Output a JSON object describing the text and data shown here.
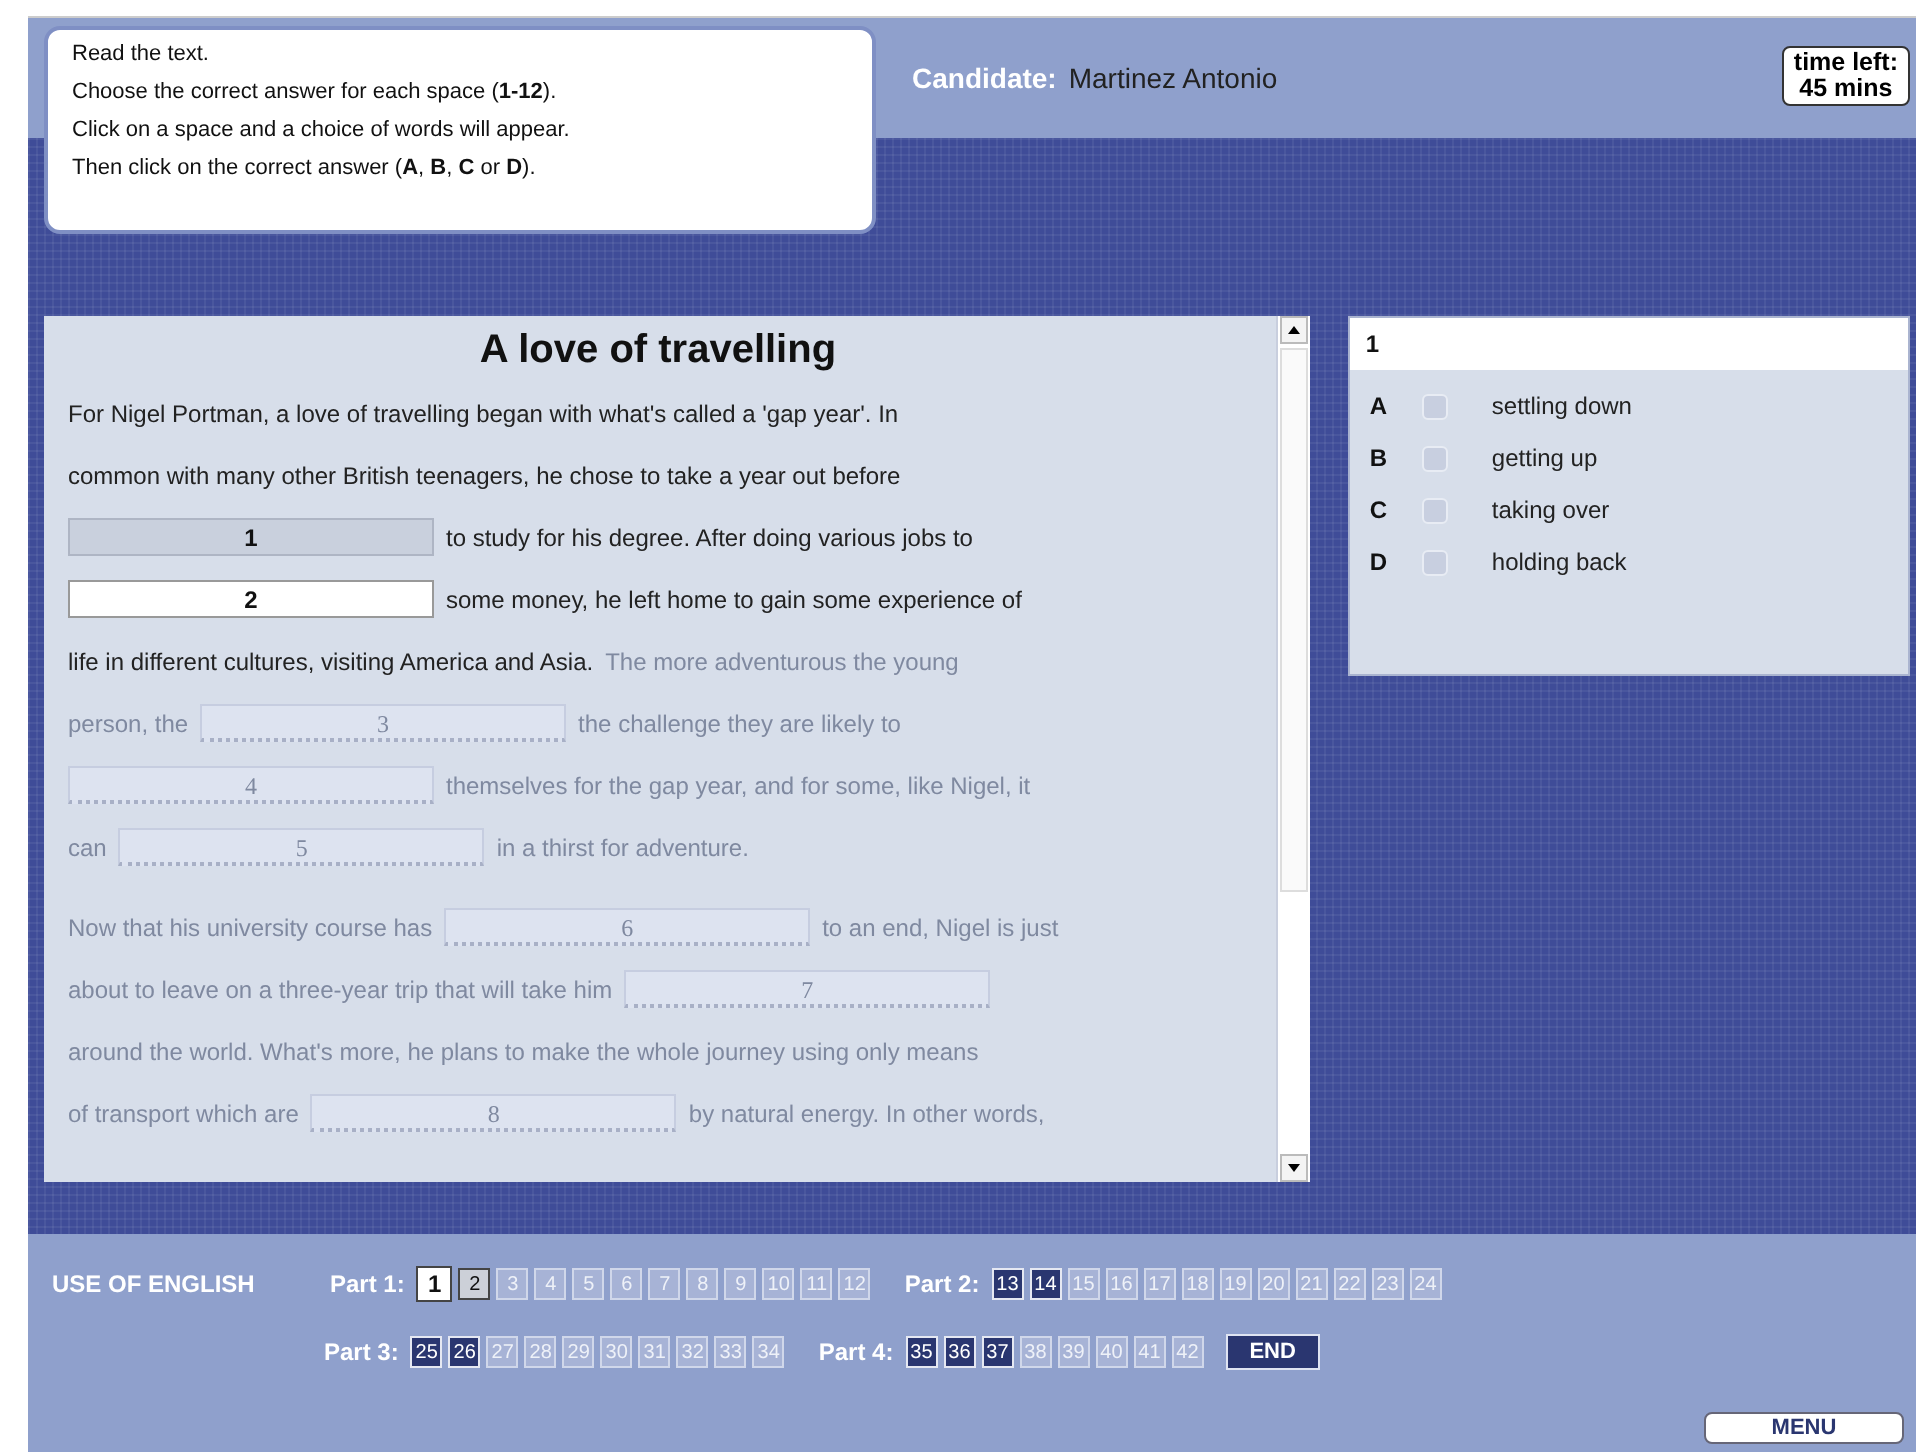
{
  "instructions": [
    "Read the text.",
    "Choose the correct answer for each space (**1-12**).",
    "Click on a space and a choice of words will appear.",
    "Then click on the correct answer (**A**, **B**, **C** or **D**)."
  ],
  "candidate": {
    "label": "Candidate:",
    "name": "Martinez Antonio"
  },
  "timer": {
    "label": "time left:",
    "value": "45 mins"
  },
  "passage": {
    "title": "A love of travelling",
    "paragraphs": [
      [
        [
          {
            "kind": "text",
            "text": "For Nigel Portman, a love of travelling began with what's called a 'gap year'. In",
            "faded": false
          }
        ],
        [
          {
            "kind": "text",
            "text": "common with many other British teenagers, he chose to take a year out before",
            "faded": false
          }
        ],
        [
          {
            "kind": "gap",
            "label": "1",
            "selected": true,
            "faded": false
          },
          {
            "kind": "text",
            "text": "to study for his degree. After doing various jobs to",
            "faded": false
          }
        ],
        [
          {
            "kind": "gap",
            "label": "2",
            "selected": false,
            "faded": false
          },
          {
            "kind": "text",
            "text": "some money, he left home to gain some experience of",
            "faded": false
          }
        ],
        [
          {
            "kind": "text",
            "text": "life in different cultures, visiting America and Asia.",
            "faded": false
          },
          {
            "kind": "text",
            "text": "The more adventurous the young",
            "faded": true
          }
        ],
        [
          {
            "kind": "text",
            "text": "person, the",
            "faded": true
          },
          {
            "kind": "gap",
            "label": "3",
            "selected": false,
            "faded": true
          },
          {
            "kind": "text",
            "text": "the challenge they are likely to",
            "faded": true
          }
        ],
        [
          {
            "kind": "gap",
            "label": "4",
            "selected": false,
            "faded": true
          },
          {
            "kind": "text",
            "text": "themselves for the gap year, and for some, like Nigel, it",
            "faded": true
          }
        ],
        [
          {
            "kind": "text",
            "text": "can",
            "faded": true
          },
          {
            "kind": "gap",
            "label": "5",
            "selected": false,
            "faded": true
          },
          {
            "kind": "text",
            "text": "in a thirst for adventure.",
            "faded": true
          }
        ]
      ],
      [
        [
          {
            "kind": "text",
            "text": "Now that his university course has",
            "faded": true
          },
          {
            "kind": "gap",
            "label": "6",
            "selected": false,
            "faded": true
          },
          {
            "kind": "text",
            "text": "to an end, Nigel is just",
            "faded": true
          }
        ],
        [
          {
            "kind": "text",
            "text": "about to leave on a three-year trip that will take him",
            "faded": true
          },
          {
            "kind": "gap",
            "label": "7",
            "selected": false,
            "faded": true
          }
        ],
        [
          {
            "kind": "text",
            "text": "around the world. What's more, he plans to make the whole journey using only means",
            "faded": true
          }
        ],
        [
          {
            "kind": "text",
            "text": "of transport which are",
            "faded": true
          },
          {
            "kind": "gap",
            "label": "8",
            "selected": false,
            "faded": true
          },
          {
            "kind": "text",
            "text": "by natural energy. In other words,",
            "faded": true
          }
        ]
      ]
    ]
  },
  "answers": {
    "question": "1",
    "options": [
      {
        "letter": "A",
        "text": "settling down",
        "checked": false
      },
      {
        "letter": "B",
        "text": "getting up",
        "checked": false
      },
      {
        "letter": "C",
        "text": "taking over",
        "checked": false
      },
      {
        "letter": "D",
        "text": "holding back",
        "checked": false
      }
    ]
  },
  "navigation": {
    "title": "USE OF ENGLISH",
    "rows": [
      [
        {
          "label": "Part 1:",
          "items": [
            {
              "label": "1",
              "selected": true,
              "visited": true,
              "answered": false
            },
            {
              "label": "2",
              "selected": false,
              "visited": true,
              "answered": false
            },
            {
              "label": "3",
              "selected": false,
              "visited": false,
              "answered": false
            },
            {
              "label": "4",
              "selected": false,
              "visited": false,
              "answered": false
            },
            {
              "label": "5",
              "selected": false,
              "visited": false,
              "answered": false
            },
            {
              "label": "6",
              "selected": false,
              "visited": false,
              "answered": false
            },
            {
              "label": "7",
              "selected": false,
              "visited": false,
              "answered": false
            },
            {
              "label": "8",
              "selected": false,
              "visited": false,
              "answered": false
            },
            {
              "label": "9",
              "selected": false,
              "visited": false,
              "answered": false
            },
            {
              "label": "10",
              "selected": false,
              "visited": false,
              "answered": false
            },
            {
              "label": "11",
              "selected": false,
              "visited": false,
              "answered": false
            },
            {
              "label": "12",
              "selected": false,
              "visited": false,
              "answered": false
            }
          ]
        },
        {
          "label": "Part 2:",
          "items": [
            {
              "label": "13",
              "selected": false,
              "visited": true,
              "answered": true
            },
            {
              "label": "14",
              "selected": false,
              "visited": true,
              "answered": true
            },
            {
              "label": "15",
              "selected": false,
              "visited": false,
              "answered": false
            },
            {
              "label": "16",
              "selected": false,
              "visited": false,
              "answered": false
            },
            {
              "label": "17",
              "selected": false,
              "visited": false,
              "answered": false
            },
            {
              "label": "18",
              "selected": false,
              "visited": false,
              "answered": false
            },
            {
              "label": "19",
              "selected": false,
              "visited": false,
              "answered": false
            },
            {
              "label": "20",
              "selected": false,
              "visited": false,
              "answered": false
            },
            {
              "label": "21",
              "selected": false,
              "visited": false,
              "answered": false
            },
            {
              "label": "22",
              "selected": false,
              "visited": false,
              "answered": false
            },
            {
              "label": "23",
              "selected": false,
              "visited": false,
              "answered": false
            },
            {
              "label": "24",
              "selected": false,
              "visited": false,
              "answered": false
            }
          ]
        }
      ],
      [
        {
          "label": "Part 3:",
          "items": [
            {
              "label": "25",
              "selected": false,
              "visited": true,
              "answered": true
            },
            {
              "label": "26",
              "selected": false,
              "visited": true,
              "answered": true
            },
            {
              "label": "27",
              "selected": false,
              "visited": false,
              "answered": false
            },
            {
              "label": "28",
              "selected": false,
              "visited": false,
              "answered": false
            },
            {
              "label": "29",
              "selected": false,
              "visited": false,
              "answered": false
            },
            {
              "label": "30",
              "selected": false,
              "visited": false,
              "answered": false
            },
            {
              "label": "31",
              "selected": false,
              "visited": false,
              "answered": false
            },
            {
              "label": "32",
              "selected": false,
              "visited": false,
              "answered": false
            },
            {
              "label": "33",
              "selected": false,
              "visited": false,
              "answered": false
            },
            {
              "label": "34",
              "selected": false,
              "visited": false,
              "answered": false
            }
          ]
        },
        {
          "label": "Part 4:",
          "items": [
            {
              "label": "35",
              "selected": false,
              "visited": true,
              "answered": true
            },
            {
              "label": "36",
              "selected": false,
              "visited": true,
              "answered": true
            },
            {
              "label": "37",
              "selected": false,
              "visited": true,
              "answered": true
            },
            {
              "label": "38",
              "selected": false,
              "visited": false,
              "answered": false
            },
            {
              "label": "39",
              "selected": false,
              "visited": false,
              "answered": false
            },
            {
              "label": "40",
              "selected": false,
              "visited": false,
              "answered": false
            },
            {
              "label": "41",
              "selected": false,
              "visited": false,
              "answered": false
            },
            {
              "label": "42",
              "selected": false,
              "visited": false,
              "answered": false
            }
          ]
        }
      ]
    ],
    "end_button": "END"
  },
  "menu_button": "MENU"
}
